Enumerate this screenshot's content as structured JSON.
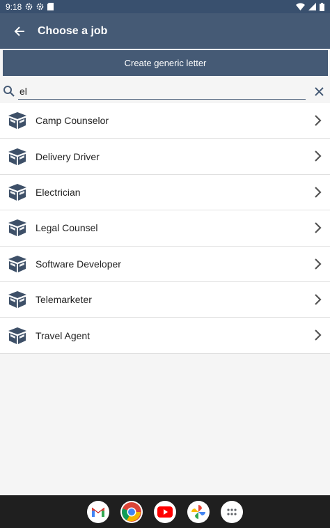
{
  "status_bar": {
    "time": "9:18"
  },
  "app_bar": {
    "title": "Choose a job"
  },
  "generic_button": {
    "label": "Create generic letter"
  },
  "search": {
    "value": "el"
  },
  "jobs": [
    {
      "label": "Camp Counselor"
    },
    {
      "label": "Delivery Driver"
    },
    {
      "label": "Electrician"
    },
    {
      "label": "Legal Counsel"
    },
    {
      "label": "Software Developer"
    },
    {
      "label": "Telemarketer"
    },
    {
      "label": "Travel Agent"
    }
  ],
  "colors": {
    "primary": "#455a75",
    "status": "#39506e",
    "icon": "#3e5068"
  },
  "dock": [
    "gmail-icon",
    "chrome-icon",
    "youtube-icon",
    "photos-icon",
    "apps-icon"
  ]
}
